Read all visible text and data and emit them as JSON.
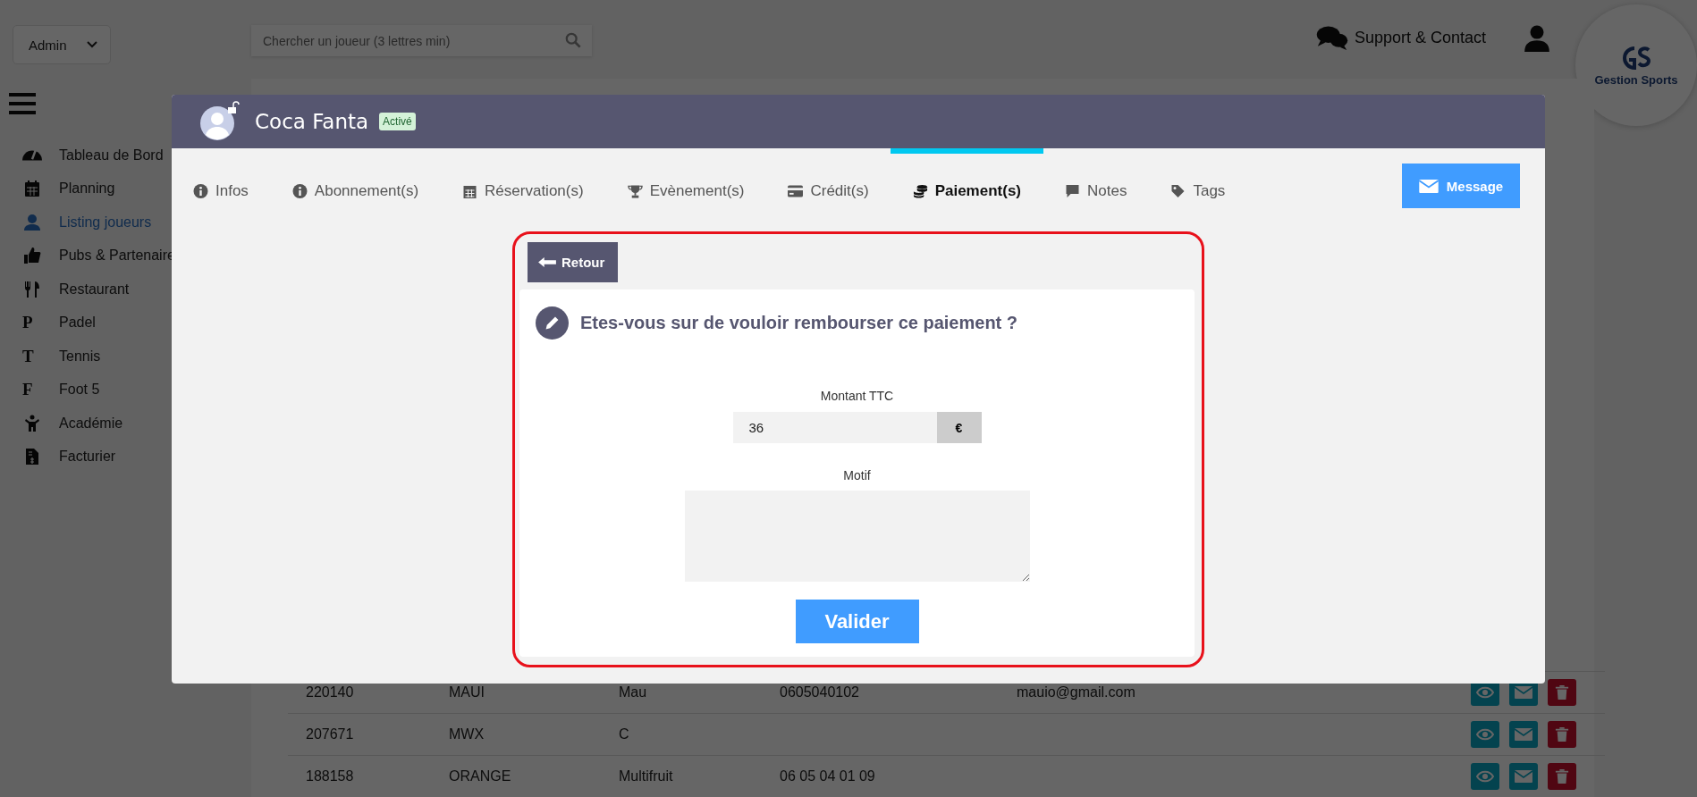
{
  "topbar": {
    "role_select": "Admin",
    "search": {
      "placeholder": "Chercher un joueur (3 lettres min)"
    },
    "support_link": "Support & Contact",
    "logo_text": "Gestion Sports"
  },
  "sidebar": {
    "items": [
      {
        "label": "Tableau de Bord",
        "kind": "gauge",
        "selected": false
      },
      {
        "label": "Planning",
        "kind": "calendar",
        "selected": false
      },
      {
        "label": "Listing joueurs",
        "kind": "user",
        "selected": true
      },
      {
        "label": "Pubs & Partenaire",
        "kind": "thumb",
        "selected": false
      },
      {
        "label": "Restaurant",
        "kind": "cutlery",
        "selected": false
      },
      {
        "label": "Padel",
        "kind": "letter",
        "glyph": "P",
        "selected": false
      },
      {
        "label": "Tennis",
        "kind": "letter",
        "glyph": "T",
        "selected": false
      },
      {
        "label": "Foot 5",
        "kind": "letter",
        "glyph": "F",
        "selected": false
      },
      {
        "label": "Académie",
        "kind": "child",
        "selected": false
      },
      {
        "label": "Facturier",
        "kind": "invoice",
        "selected": false
      }
    ]
  },
  "table": {
    "rows": [
      {
        "cells": [
          "220140",
          "MAUI",
          "Mau",
          "0605040102",
          "mauio@gmail.com"
        ]
      },
      {
        "cells": [
          "207671",
          "MWX",
          "C",
          "",
          ""
        ]
      },
      {
        "cells": [
          "188158",
          "ORANGE",
          "Multifruit",
          "06 05 04 01 09",
          ""
        ]
      }
    ]
  },
  "modal": {
    "title": "Coca Fanta",
    "status": "Activé",
    "tabs": [
      {
        "label": "Infos",
        "kind": "info",
        "selected": false
      },
      {
        "label": "Abonnement(s)",
        "kind": "info",
        "selected": false
      },
      {
        "label": "Réservation(s)",
        "kind": "calendar",
        "selected": false
      },
      {
        "label": "Evènement(s)",
        "kind": "trophy",
        "selected": false
      },
      {
        "label": "Crédit(s)",
        "kind": "card",
        "selected": false
      },
      {
        "label": "Paiement(s)",
        "kind": "coins",
        "selected": true
      },
      {
        "label": "Notes",
        "kind": "comment",
        "selected": false
      },
      {
        "label": "Tags",
        "kind": "tag",
        "selected": false
      }
    ],
    "message_button": "Message",
    "back_button": "Retour",
    "question": "Etes-vous sur de vouloir rembourser ce paiement ?",
    "amount": {
      "label": "Montant TTC",
      "value": "36",
      "currency": "€"
    },
    "reason": {
      "label": "Motif"
    },
    "submit": "Valider"
  }
}
